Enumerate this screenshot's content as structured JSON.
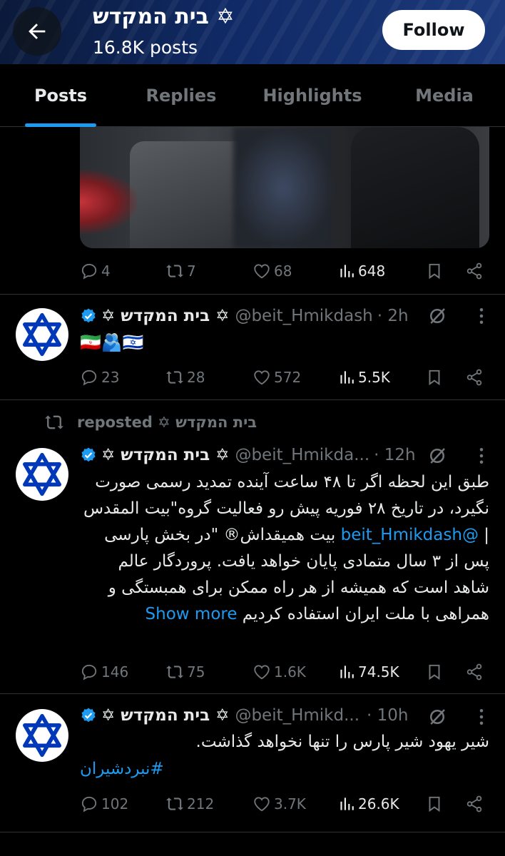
{
  "header": {
    "title": "בית המקדש ✡",
    "posts_count": "16.8K posts",
    "follow_label": "Follow"
  },
  "tabs": [
    {
      "label": "Posts",
      "active": true
    },
    {
      "label": "Replies",
      "active": false
    },
    {
      "label": "Highlights",
      "active": false
    },
    {
      "label": "Media",
      "active": false
    }
  ],
  "tweets": [
    {
      "stats": {
        "replies": "4",
        "reposts": "7",
        "likes": "68",
        "views": "648"
      }
    },
    {
      "name": "✡ בית המקדש ✡",
      "handle": "@beit_Hmikdash",
      "time": "· 2h",
      "text": "🇮🇷🫂🇮🇱",
      "stats": {
        "replies": "23",
        "reposts": "28",
        "likes": "572",
        "views": "5.5K"
      }
    },
    {
      "repost_label": "reposted ✡ בית המקדש",
      "name": "✡ בית המקדש ✡",
      "handle": "@beit_Hmikda...",
      "time": "· 12h",
      "text_part1": "طبق این لحظه اگر تا ۴۸ ساعت آینده تمدید رسمی صورت نگیرد، در تاریخ ۲۸ فوریه پیش رو فعالیت گروه\"بیت المقدس | ",
      "text_link": "@beit_Hmikdash",
      "text_part2": " بیت همیقداش® \"در بخش پارسی پس از ۳ سال متمادی پایان خواهد یافت. پروردگار عالم شاهد است که همیشه از هر راه ممکن برای همبستگی و همراهی با ملت ایران استفاده کردیم ",
      "show_more": "Show more",
      "stats": {
        "replies": "146",
        "reposts": "75",
        "likes": "1.6K",
        "views": "74.5K"
      }
    },
    {
      "name": "✡ בית המקדש ✡",
      "handle": "@beit_Hmikd...",
      "time": "· 10h",
      "text": "شیر یهود شیر پارس را تنها نخواهد گذاشت.",
      "hashtag": "#نبردشیران",
      "stats": {
        "replies": "102",
        "reposts": "212",
        "likes": "3.7K",
        "views": "26.6K"
      }
    }
  ],
  "colors": {
    "accent": "#1d9bf0",
    "muted": "#71767b",
    "text": "#e7e9ea",
    "background": "#000000"
  }
}
